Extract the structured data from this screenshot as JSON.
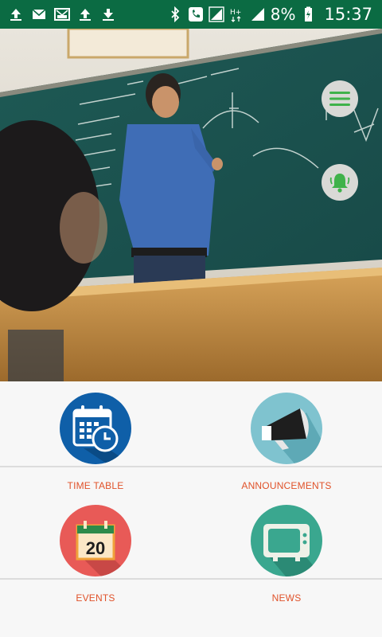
{
  "status_bar": {
    "battery_text": "8%",
    "time": "15:37",
    "left_icons": [
      "upload-icon",
      "mail-icon",
      "gallery-mail-icon",
      "upload-icon",
      "download-icon"
    ],
    "right_icons": [
      "bluetooth-icon",
      "call-icon",
      "signal-icon",
      "hplus-icon",
      "signal-icon",
      "battery-icon"
    ]
  },
  "hero": {
    "image": "classroom-teacher-blackboard-photo",
    "menu_button_icon": "hamburger-icon",
    "notify_button_icon": "bell-icon"
  },
  "tiles": [
    {
      "label": "TIME TABLE",
      "icon": "calendar-clock-icon",
      "bg": "#0f5fa8"
    },
    {
      "label": "ANNOUNCEMENTS",
      "icon": "megaphone-icon",
      "bg": "#7fc3cf"
    },
    {
      "label": "EVENTS",
      "icon": "calendar-20-icon",
      "bg": "#e85a57",
      "icon_text": "20"
    },
    {
      "label": "NEWS",
      "icon": "tv-icon",
      "bg": "#3aa78f"
    }
  ],
  "colors": {
    "status_bar": "#0b6b43",
    "label": "#e0522a",
    "fab_icon": "#3fb24a"
  }
}
